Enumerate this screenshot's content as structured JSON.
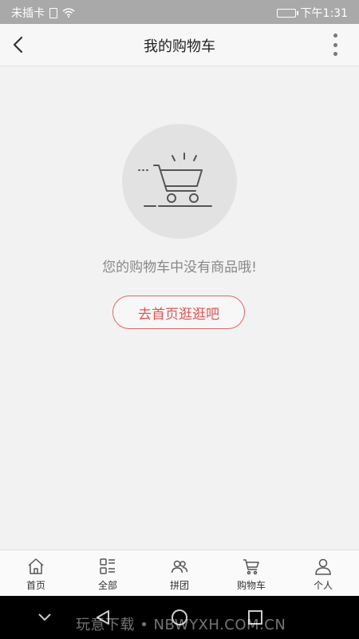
{
  "status_bar": {
    "carrier": "未插卡",
    "time": "下午1:31"
  },
  "header": {
    "title": "我的购物车"
  },
  "empty_state": {
    "message": "您的购物车中没有商品哦!",
    "button_label": "去首页逛逛吧"
  },
  "tabs": [
    {
      "label": "首页",
      "icon": "home-icon"
    },
    {
      "label": "全部",
      "icon": "category-icon"
    },
    {
      "label": "拼团",
      "icon": "group-icon"
    },
    {
      "label": "购物车",
      "icon": "cart-icon"
    },
    {
      "label": "个人",
      "icon": "user-icon"
    }
  ],
  "watermark": "玩意下载 • NBWYXH.COM.CN"
}
